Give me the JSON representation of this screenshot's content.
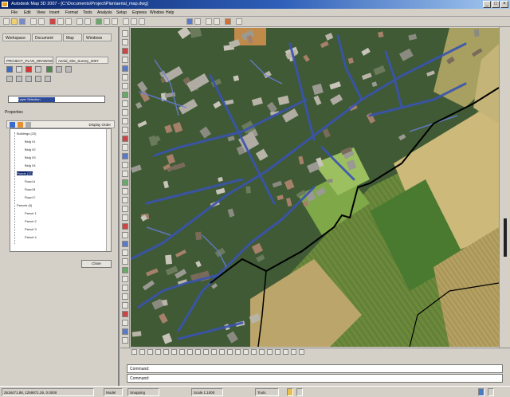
{
  "window": {
    "title": "Autodesk Map 3D 2007 - [C:\\Documents\\Project\\Plan\\aerial_map.dwg]",
    "minimize": "_",
    "maximize": "□",
    "close": "×"
  },
  "menu": {
    "items": [
      "File",
      "Edit",
      "View",
      "Insert",
      "Format",
      "Tools",
      "Analysis",
      "Setup",
      "Express",
      "Window",
      "Help"
    ]
  },
  "left_panel": {
    "tabs": [
      "Workspace",
      "Document",
      "Map",
      "Windows"
    ],
    "sub_tabs": [
      "PROJECT_PLAN_DRAWING_2007",
      "Aerial_Site_Survey_2007"
    ],
    "field_value": "Layer Selection",
    "section_label": "Properties",
    "tree_header": "Display Order",
    "tree": [
      {
        "label": "Buildings (23)",
        "indent": 0,
        "highlight": false
      },
      {
        "label": "Bldg 01",
        "indent": 1,
        "highlight": false
      },
      {
        "label": "Bldg 02",
        "indent": 1,
        "highlight": false
      },
      {
        "label": "Bldg 03",
        "indent": 1,
        "highlight": false
      },
      {
        "label": "Bldg 04",
        "indent": 1,
        "highlight": false
      },
      {
        "label": "Roads (12)",
        "indent": 0,
        "highlight": true
      },
      {
        "label": "Road A",
        "indent": 1,
        "highlight": false
      },
      {
        "label": "Road B",
        "indent": 1,
        "highlight": false
      },
      {
        "label": "Road C",
        "indent": 1,
        "highlight": false
      },
      {
        "label": "Parcels (9)",
        "indent": 0,
        "highlight": false
      },
      {
        "label": "Parcel 1",
        "indent": 1,
        "highlight": false
      },
      {
        "label": "Parcel 2",
        "indent": 1,
        "highlight": false
      },
      {
        "label": "Parcel 3",
        "indent": 1,
        "highlight": false
      },
      {
        "label": "Parcel 4",
        "indent": 1,
        "highlight": false
      }
    ],
    "close_button": "Close"
  },
  "command": {
    "line1": "Command:",
    "line2": "Command:"
  },
  "status": {
    "coords": "2618471.88, 1259871.26, 0.0000",
    "model": "Model",
    "snap": "Snapping",
    "scale": "Scale 1:1000",
    "tools": "Tools"
  },
  "colors": {
    "title_bar": "#0a246a",
    "selection": "#0a246a",
    "road_overlay": "#3a54b0",
    "parcel_boundary": "#000000"
  }
}
